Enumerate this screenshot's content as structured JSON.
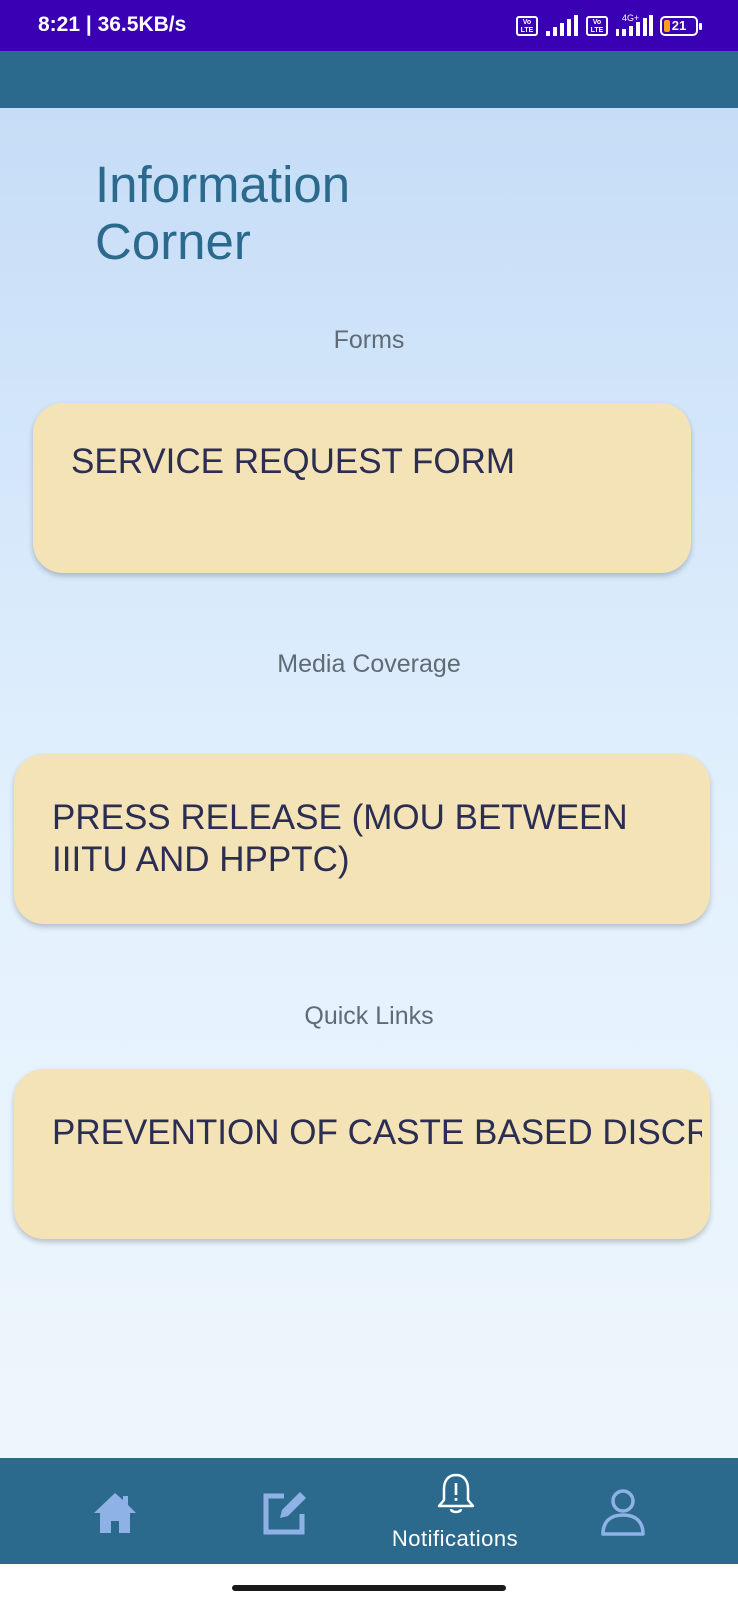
{
  "status_bar": {
    "time": "8:21 | 36.5KB/s",
    "volte_label": "Vo LTE",
    "network_label": "4G+",
    "battery": "21"
  },
  "page": {
    "title": "Information Corner"
  },
  "sections": [
    {
      "heading": "Forms",
      "card": "SERVICE REQUEST FORM"
    },
    {
      "heading": "Media Coverage",
      "card": "PRESS RELEASE (MOU BETWEEN IIITU AND HPPTC)"
    },
    {
      "heading": "Quick Links",
      "card": "PREVENTION OF CASTE BASED DISCRIMINATION IN OUR INSTITUTE ..."
    }
  ],
  "nav": {
    "items": [
      {
        "icon": "home-icon"
      },
      {
        "icon": "edit-icon"
      },
      {
        "icon": "bell-icon",
        "label": "Notifications"
      },
      {
        "icon": "person-icon"
      }
    ]
  },
  "colors": {
    "status_bar": "#3a00b4",
    "app_bar": "#2c6a8d",
    "card": "#f3e3b6",
    "title": "#2c6a8d",
    "nav_icon": "#8fb2e6"
  }
}
